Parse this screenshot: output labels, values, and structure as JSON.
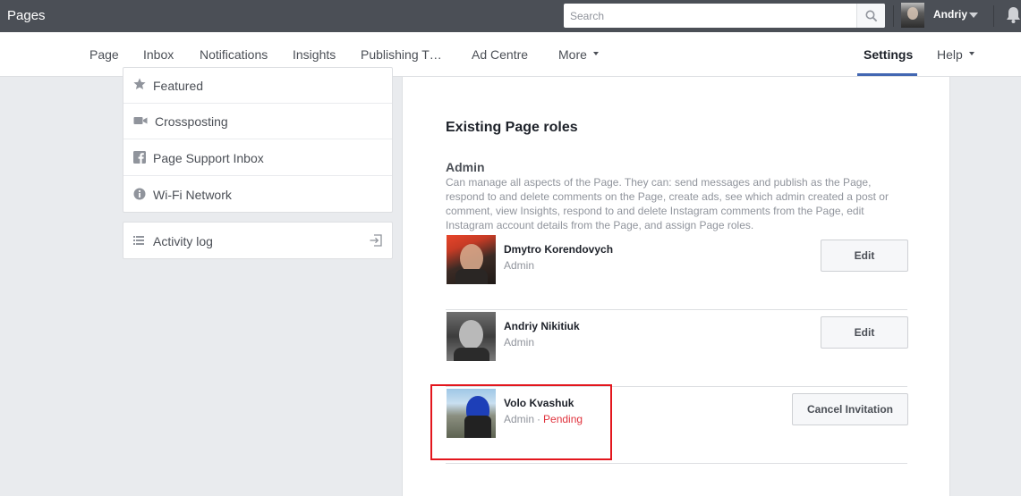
{
  "topbar": {
    "brand": "Pages",
    "search_placeholder": "Search",
    "user_name": "Andriy"
  },
  "tabs": [
    {
      "label": "Page"
    },
    {
      "label": "Inbox"
    },
    {
      "label": "Notifications"
    },
    {
      "label": "Insights"
    },
    {
      "label": "Publishing T…"
    },
    {
      "label": "Ad Centre"
    },
    {
      "label": "More"
    },
    {
      "label": "Settings",
      "active": true
    },
    {
      "label": "Help"
    }
  ],
  "sidebar": {
    "items": [
      {
        "label": "Featured",
        "icon": "star-icon"
      },
      {
        "label": "Crossposting",
        "icon": "video-camera-icon"
      },
      {
        "label": "Page Support Inbox",
        "icon": "facebook-icon"
      },
      {
        "label": "Wi-Fi Network",
        "icon": "info-icon"
      }
    ],
    "activity_log": {
      "label": "Activity log",
      "icon": "list-icon"
    }
  },
  "main": {
    "section_title": "Existing Page roles",
    "admin_heading": "Admin",
    "admin_description": "Can manage all aspects of the Page. They can: send messages and publish as the Page, respond to and delete comments on the Page, create ads, see which admin created a post or comment, view Insights, respond to and delete Instagram comments from the Page, edit Instagram account details from the Page, and assign Page roles.",
    "people": [
      {
        "name": "Dmytro Korendovych",
        "role": "Admin",
        "status": "",
        "button": "Edit"
      },
      {
        "name": "Andriy Nikitiuk",
        "role": "Admin",
        "status": "",
        "button": "Edit"
      },
      {
        "name": "Volo Kvashuk",
        "role": "Admin",
        "status": "Pending",
        "button": "Cancel Invitation"
      }
    ]
  },
  "colors": {
    "topbar": "#4b4f56",
    "accent": "#4267b2",
    "pending": "#e0333d",
    "highlight": "#e3161d"
  }
}
